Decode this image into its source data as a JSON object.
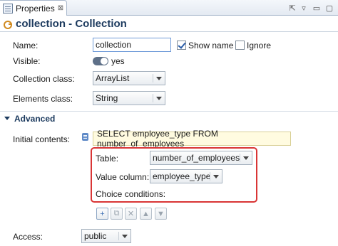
{
  "tab": {
    "label": "Properties",
    "close": "⊠"
  },
  "toolbar": {
    "pin": "⇱",
    "menu": "▿",
    "minimize": "▭",
    "maximize": "▢"
  },
  "header": {
    "title": "collection - Collection"
  },
  "form": {
    "name_label": "Name:",
    "name_value": "collection",
    "show_name_label": "Show name",
    "show_name_checked": true,
    "ignore_label": "Ignore",
    "ignore_checked": false,
    "visible_label": "Visible:",
    "visible_value": "yes",
    "collection_class_label": "Collection class:",
    "collection_class_value": "ArrayList",
    "elements_class_label": "Elements class:",
    "elements_class_value": "String"
  },
  "advanced": {
    "title": "Advanced",
    "initial_contents_label": "Initial contents:",
    "query": "SELECT employee_type FROM number_of_employees",
    "table_label": "Table:",
    "table_value": "number_of_employees",
    "value_column_label": "Value column:",
    "value_column_value": "employee_type",
    "choice_conditions_label": "Choice conditions:",
    "access_label": "Access:",
    "access_value": "public"
  },
  "conditions_toolbar": {
    "add": "+",
    "copy": "⧉",
    "remove": "✕",
    "up": "▲",
    "down": "▼"
  },
  "colors": {
    "highlight": "#d93535",
    "accent": "#1c3a5e",
    "query_bg": "#fffbe0"
  }
}
